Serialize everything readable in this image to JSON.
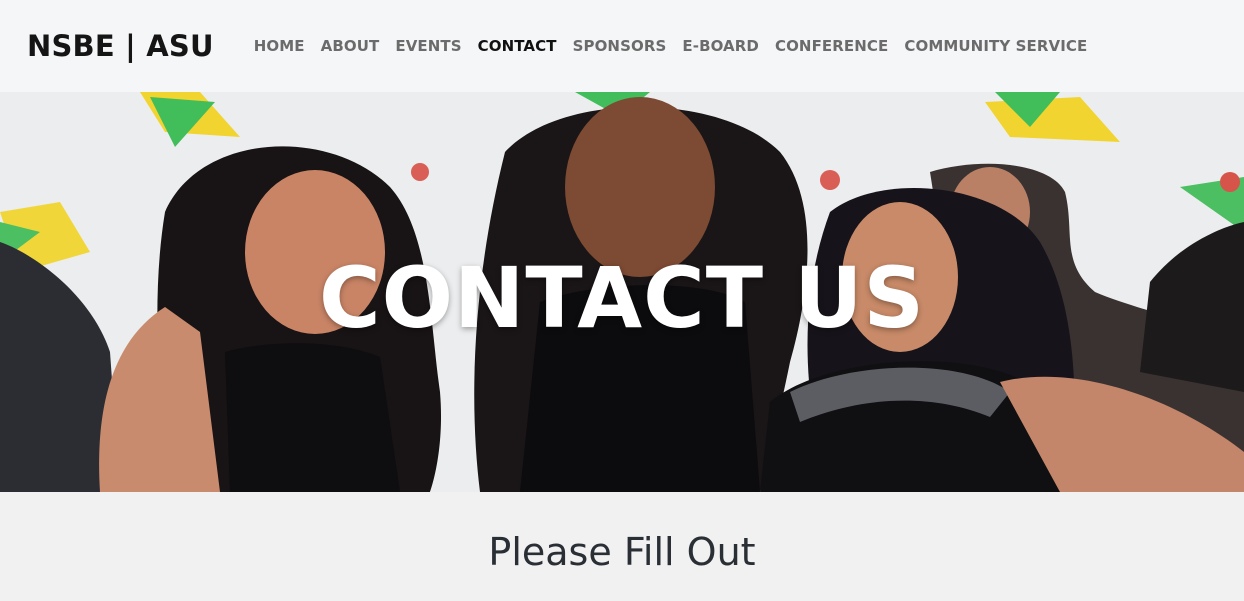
{
  "brand": "NSBE | ASU",
  "nav": [
    {
      "label": "HOME"
    },
    {
      "label": "ABOUT"
    },
    {
      "label": "EVENTS"
    },
    {
      "label": "CONTACT"
    },
    {
      "label": "SPONSORS"
    },
    {
      "label": "E-BOARD"
    },
    {
      "label": "CONFERENCE"
    },
    {
      "label": "COMMUNITY SERVICE"
    }
  ],
  "active_nav": "CONTACT",
  "hero": {
    "title": "CONTACT US"
  },
  "section": {
    "title": "Please Fill Out"
  },
  "colors": {
    "accent_green": "#2fb84a",
    "accent_yellow": "#f2d21b",
    "nav_bg": "#f5f6f8",
    "page_bg": "#f1f1f1"
  }
}
